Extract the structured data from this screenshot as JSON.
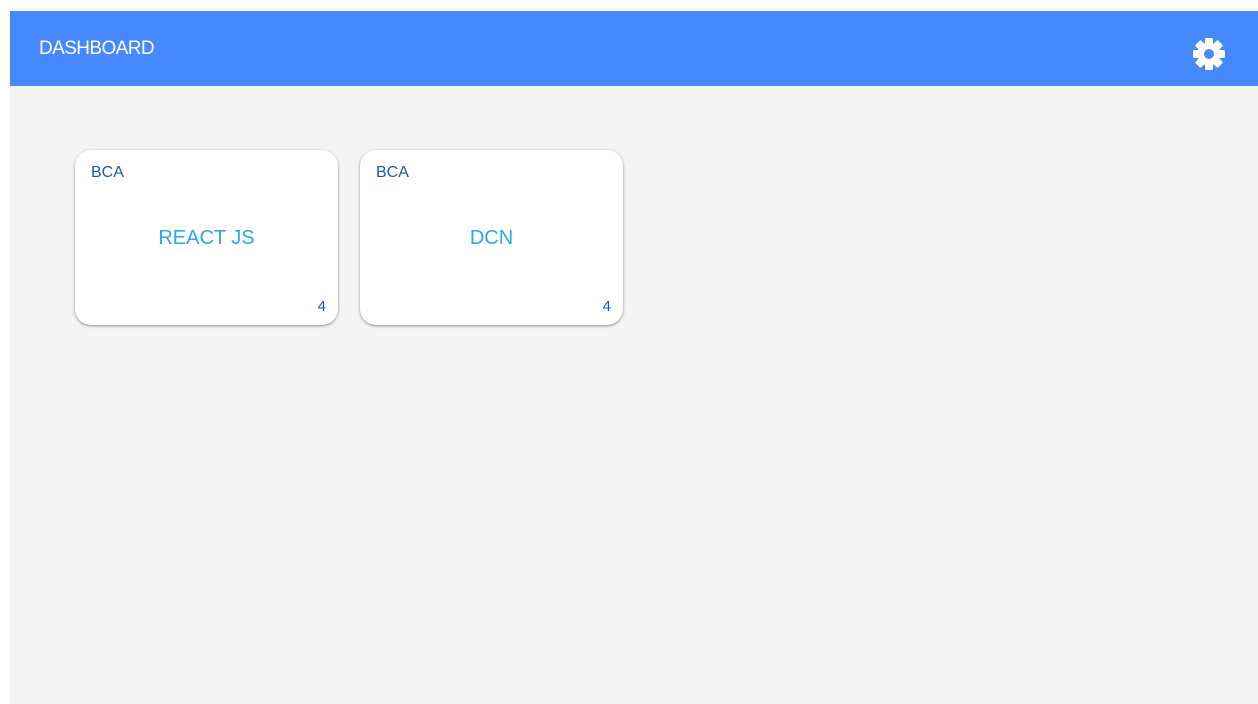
{
  "header": {
    "title": "DASHBOARD",
    "settings_icon": "gear-icon",
    "background_color": "#4688fd"
  },
  "cards": [
    {
      "department": "BCA",
      "subject": "REACT JS",
      "count": "4"
    },
    {
      "department": "BCA",
      "subject": "DCN",
      "count": "4"
    }
  ],
  "colors": {
    "page_background": "#f4f4f4",
    "department_text": "#1e5a9c",
    "subject_text": "#2ba8e6"
  }
}
